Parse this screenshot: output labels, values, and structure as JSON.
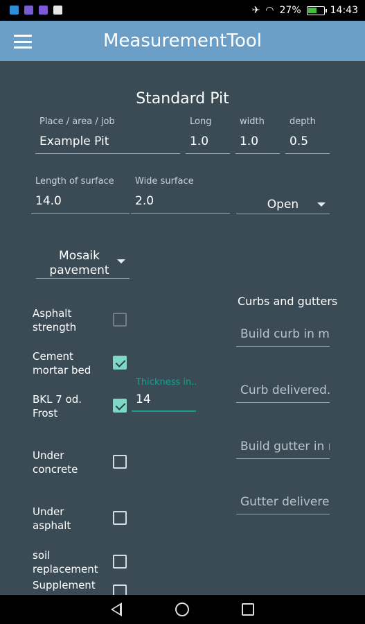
{
  "status_bar": {
    "battery": "27%",
    "time": "14:43"
  },
  "app_bar": {
    "title": "MeasurementTool"
  },
  "form": {
    "section_title": "Standard Pit",
    "place_label": "Place / area / job",
    "place_value": "Example Pit",
    "long_label": "Long",
    "long_value": "1.0",
    "width_label": "width",
    "width_value": "1.0",
    "depth_label": "depth",
    "depth_value": "0.5",
    "length_surface_label": "Length of surface",
    "length_surface_value": "14.0",
    "wide_surface_label": "Wide surface",
    "wide_surface_value": "2.0",
    "open_spinner": "Open",
    "pavement_spinner": "Mosaik\npavement",
    "checks": [
      {
        "label": "Asphalt\nstrength",
        "checked": false,
        "enabled": false
      },
      {
        "label": "Cement\nmortar bed",
        "checked": true,
        "enabled": true
      },
      {
        "label": "BKL 7 od.\nFrost",
        "checked": true,
        "enabled": true
      },
      {
        "label": "Under\nconcrete",
        "checked": false,
        "enabled": true
      },
      {
        "label": "Under\nasphalt",
        "checked": false,
        "enabled": true
      },
      {
        "label": "soil\nreplacement",
        "checked": false,
        "enabled": true
      },
      {
        "label": "Supplement",
        "checked": false,
        "enabled": true
      }
    ],
    "thickness_label": "Thickness in...",
    "thickness_value": "14"
  },
  "curbs": {
    "title": "Curbs and gutters",
    "build_curb_placeholder": "Build curb in m",
    "curb_delivered_placeholder": "Curb delivered...",
    "build_gutter_placeholder": "Build gutter in m",
    "gutter_delivered_placeholder": "Gutter delivere..."
  },
  "colors": {
    "background": "#3b4b55",
    "app_bar": "#6b9fc8",
    "accent": "#16a08d",
    "checkbox_checked": "#7fd8c6"
  }
}
